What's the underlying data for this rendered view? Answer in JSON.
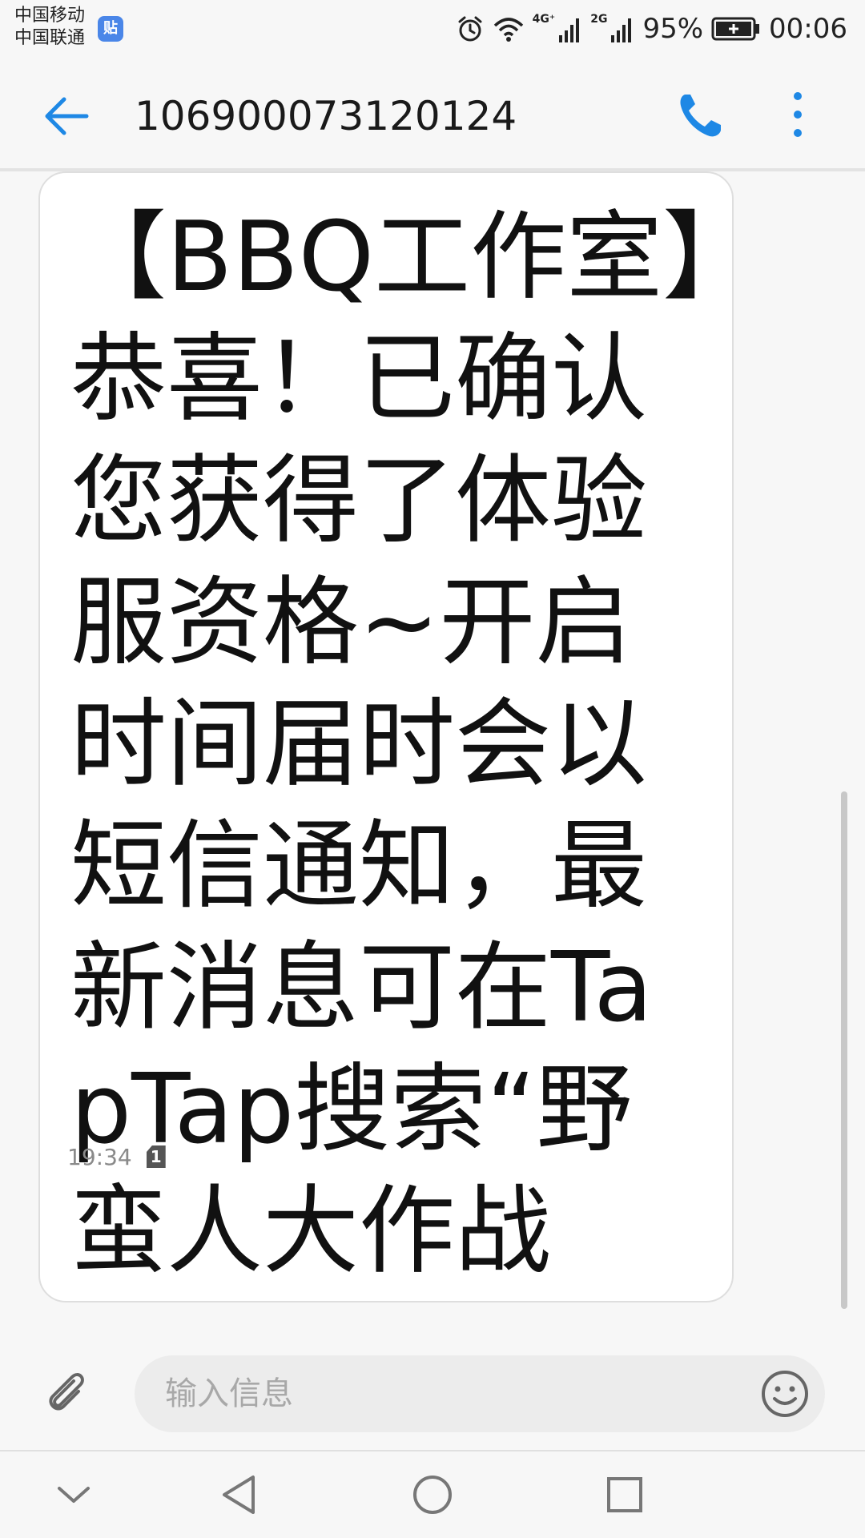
{
  "status_bar": {
    "carrier_1": "中国移动",
    "carrier_2": "中国联通",
    "tieba_badge": "贴",
    "network_4g": "4G⁺",
    "network_2g": "2G",
    "battery": "95%",
    "time": "00:06"
  },
  "header": {
    "contact": "106900073120124",
    "back_icon": "arrow-left-icon",
    "call_icon": "phone-icon",
    "more_icon": "more-vertical-icon"
  },
  "message": {
    "text": "【BBQ工作室】恭喜！已确认您获得了体验服资格~开启时间届时会以短信通知，最新消息可在TapTap搜索“野蛮人大作战",
    "time": "19:34",
    "sim": "1"
  },
  "compose": {
    "placeholder": "输入信息",
    "attach_icon": "paperclip-icon",
    "emoji_icon": "smiley-icon"
  },
  "nav": {
    "hide_icon": "chevron-down-icon",
    "back_icon": "triangle-back-icon",
    "home_icon": "circle-home-icon",
    "recents_icon": "square-recents-icon"
  },
  "colors": {
    "accent": "#1e88e5",
    "background": "#f7f7f7",
    "bubble": "#ffffff"
  }
}
